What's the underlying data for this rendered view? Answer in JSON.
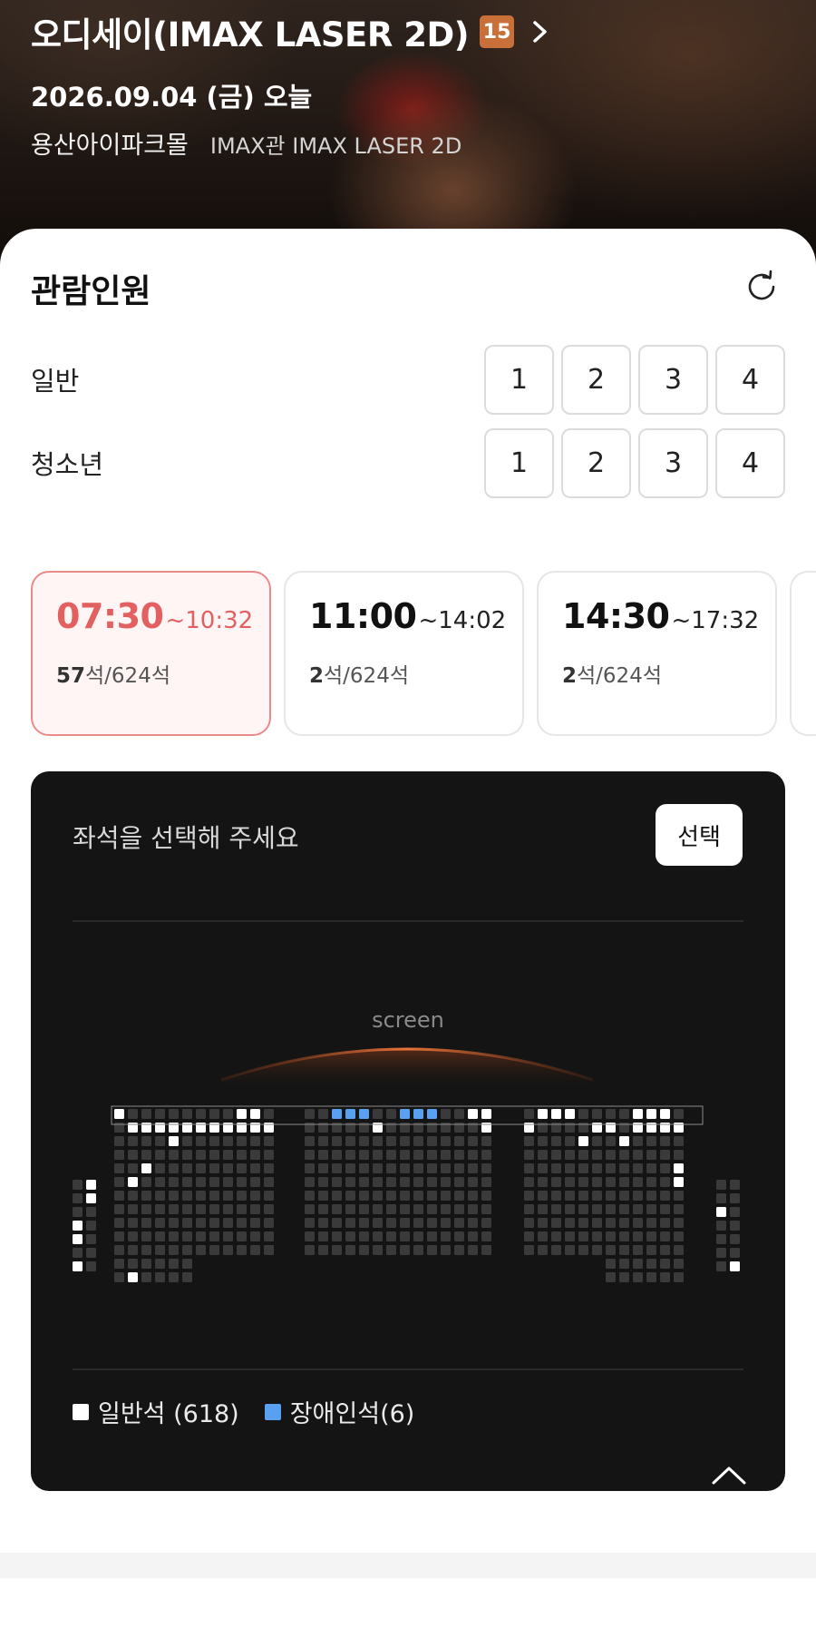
{
  "movie": {
    "title": "오디세이(IMAX LASER 2D)",
    "age_rating": "15",
    "date": "2026.09.04 (금) 오늘",
    "cinema": "용산아이파크몰",
    "hall": "IMAX관 IMAX LASER 2D"
  },
  "icons": {
    "chevron": "chevron-right-icon",
    "refresh": "refresh-icon",
    "collapse": "chevron-up-icon"
  },
  "audience": {
    "title": "관람인원",
    "rows": [
      {
        "label": "일반",
        "options": [
          "1",
          "2",
          "3",
          "4"
        ]
      },
      {
        "label": "청소년",
        "options": [
          "1",
          "2",
          "3",
          "4"
        ]
      }
    ]
  },
  "showtimes": [
    {
      "start": "07:30",
      "end": "~10:32",
      "available": "57",
      "seat_suffix": "석/624석",
      "selected": true
    },
    {
      "start": "11:00",
      "end": "~14:02",
      "available": "2",
      "seat_suffix": "석/624석",
      "selected": false
    },
    {
      "start": "14:30",
      "end": "~17:32",
      "available": "2",
      "seat_suffix": "석/624석",
      "selected": false
    }
  ],
  "seat_map": {
    "prompt": "좌석을 선택해 주세요",
    "select_label": "선택",
    "screen_label": "screen",
    "legend": [
      {
        "label": "일반석 (618)",
        "color": "#ffffff"
      },
      {
        "label": "장애인석(6)",
        "color": "#5aa0f0"
      }
    ]
  },
  "colors": {
    "accent": "#e26060",
    "seat_taken": "#3a3a3a",
    "seat_available": "#ffffff",
    "seat_accessible": "#5aa0f0",
    "panel_bg": "#141414"
  }
}
